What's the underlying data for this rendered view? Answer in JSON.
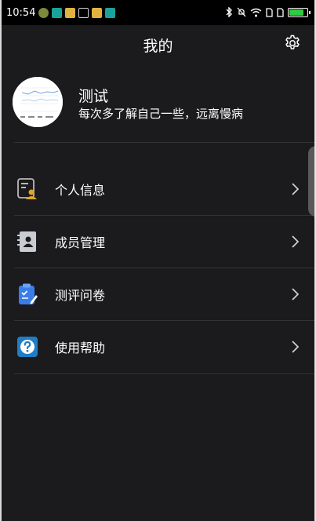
{
  "status_bar": {
    "time": "10:54",
    "icons": [
      "app-icon-1",
      "app-icon-2",
      "folder-icon",
      "upload-icon",
      "folder-icon",
      "usb-icon"
    ],
    "right_icons": [
      "bluetooth-icon",
      "mute-icon",
      "wifi-icon",
      "sim-icon",
      "sim-icon",
      "battery-icon"
    ],
    "battery_level": 0.8
  },
  "header": {
    "title": "我的"
  },
  "profile": {
    "name": "测试",
    "motto": "每次多了解自己一些，远离慢病"
  },
  "menu": {
    "items": [
      {
        "label": "个人信息",
        "icon": "personal-info-icon"
      },
      {
        "label": "成员管理",
        "icon": "member-management-icon"
      },
      {
        "label": "测评问卷",
        "icon": "questionnaire-icon"
      },
      {
        "label": "使用帮助",
        "icon": "help-icon"
      }
    ]
  },
  "colors": {
    "background": "#1b1b1d",
    "status_bar": "#000000",
    "divider": "#333336",
    "text": "#ffffff",
    "help_blue": "#1e7ec8",
    "questionnaire_blue": "#3b7de8"
  }
}
